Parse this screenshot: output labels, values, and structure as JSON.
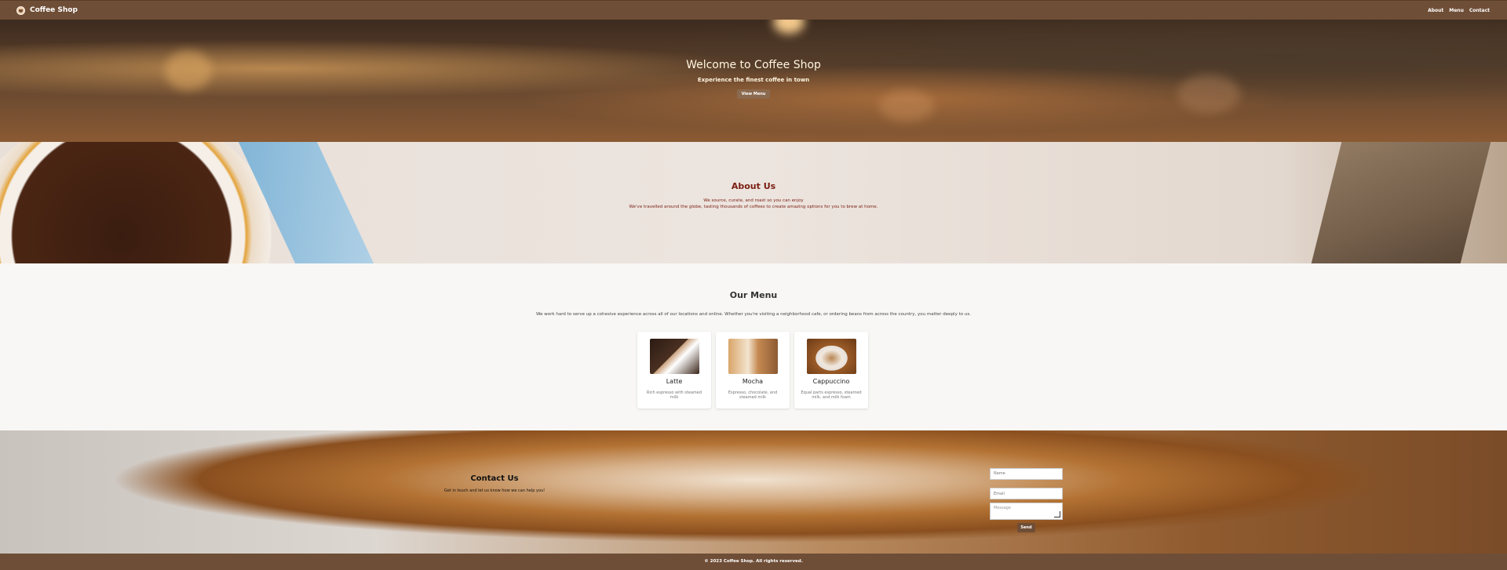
{
  "nav": {
    "brand": "Coffee Shop",
    "logo_icon": "coffee-cup-icon",
    "links": [
      "About",
      "Menu",
      "Contact"
    ]
  },
  "hero": {
    "title": "Welcome to Coffee Shop",
    "subtitle": "Experience the finest coffee in town",
    "button": "View Menu"
  },
  "about": {
    "title": "About Us",
    "line1": "We source, curate, and roast so you can enjoy",
    "line2": "We've travelled around the globe, tasting thousands of coffees to create amazing options for you to brew at home."
  },
  "menu": {
    "title": "Our Menu",
    "intro": "We work hard to serve up a cohesive experience across all of our locations and online. Whether you're visiting a neighborhood cafe, or ordering beans from across the country, you matter deeply to us.",
    "items": [
      {
        "name": "Latte",
        "desc": "Rich espresso with steamed milk"
      },
      {
        "name": "Mocha",
        "desc": "Espresso, chocolate, and steamed milk"
      },
      {
        "name": "Cappuccino",
        "desc": "Equal parts espresso, steamed milk, and milk foam"
      }
    ]
  },
  "contact": {
    "title": "Contact Us",
    "text": "Get in touch and let us know how we can help you!",
    "name_placeholder": "Name",
    "email_placeholder": "Email",
    "message_placeholder": "Message",
    "send": "Send"
  },
  "footer": {
    "text": "© 2023 Coffee Shop. All rights reserved."
  },
  "colors": {
    "brand": "#6f4e37",
    "about_heading": "#7a1e12"
  }
}
